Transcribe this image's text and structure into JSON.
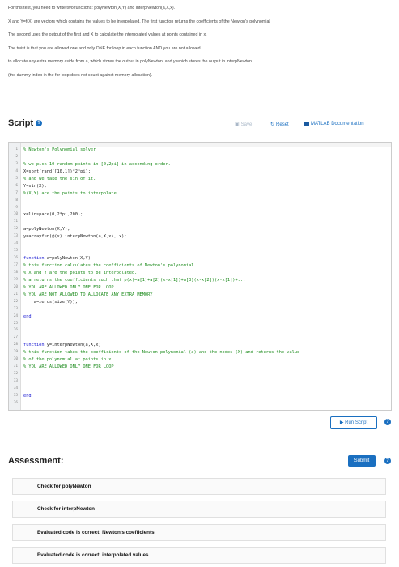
{
  "description": [
    "For this test, you need to write two functions: polyNewton(X,Y) and interpNewton(a,X,x).",
    "X and Y=f(X) are vectors which contains the values to be interpolated. The first function returns the coefficients of the Newton's polynomial",
    "The second uses the output of the first and X to calculate the interpolated values at points contained in x.",
    "The twist is that you are allowed one and only ONE for loop in each function AND you are not allowed",
    "to allocate any extra memory aside from a, which stores the output in polyNewton, and y which stores the output in interpNewton",
    "(the dummy index in the for loop does not count against memory allocation)."
  ],
  "script": {
    "title": "Script",
    "save_label": "Save",
    "reset_label": "Reset",
    "docs_label": "MATLAB Documentation"
  },
  "code_lines": [
    {
      "n": "1",
      "t": "% Newton's Polynomial solver",
      "c": true
    },
    {
      "n": "2",
      "t": "",
      "c": false
    },
    {
      "n": "3",
      "t": "% we pick 10 random points in [0,2pi] in ascending order.",
      "c": true
    },
    {
      "n": "4",
      "t": "X=sort(rand([10,1])*2*pi);",
      "c": false
    },
    {
      "n": "5",
      "t": "% and we take the sin of it.",
      "c": true
    },
    {
      "n": "6",
      "t": "Y=sin(X);",
      "c": false
    },
    {
      "n": "7",
      "t": "%(X,Y) are the points to interpolate.",
      "c": true
    },
    {
      "n": "8",
      "t": "",
      "c": false
    },
    {
      "n": "9",
      "t": "",
      "c": false
    },
    {
      "n": "10",
      "t": "x=linspace(0,2*pi,200);",
      "c": false
    },
    {
      "n": "11",
      "t": "",
      "c": false
    },
    {
      "n": "12",
      "t": "a=polyNewton(X,Y);",
      "c": false
    },
    {
      "n": "13",
      "t": "y=arrayfun(@(x) interpNewton(a,X,x), x);",
      "c": false
    },
    {
      "n": "14",
      "t": "",
      "c": false
    },
    {
      "n": "15",
      "t": "",
      "c": false
    },
    {
      "n": "16",
      "t": "function a=polyNewton(X,Y)",
      "c": false,
      "kw": "function"
    },
    {
      "n": "17",
      "t": "% this function calculates the coefficients of Newton's polynomial",
      "c": true
    },
    {
      "n": "18",
      "t": "% X and Y are the points to be interpolated.",
      "c": true
    },
    {
      "n": "19",
      "t": "% a returns the coefficients such that p(x)=a[1]+a[2](x-x[1])+a[3](x-x[2])(x-x[1])+...",
      "c": true
    },
    {
      "n": "20",
      "t": "% YOU ARE ALLOWED ONLY ONE FOR LOOP",
      "c": true
    },
    {
      "n": "21",
      "t": "% YOU ARE NOT ALLOWED TO ALLOCATE ANY EXTRA MEMORY",
      "c": true
    },
    {
      "n": "22",
      "t": "    a=zeros(size(Y));",
      "c": false
    },
    {
      "n": "23",
      "t": "",
      "c": false
    },
    {
      "n": "24",
      "t": "end",
      "c": false,
      "kw": "end"
    },
    {
      "n": "25",
      "t": "",
      "c": false
    },
    {
      "n": "26",
      "t": "",
      "c": false
    },
    {
      "n": "27",
      "t": "",
      "c": false
    },
    {
      "n": "28",
      "t": "function y=interpNewton(a,X,x)",
      "c": false,
      "kw": "function"
    },
    {
      "n": "29",
      "t": "% this function takes the coefficients of the Newton polynomial (a) and the nodes (X) and returns the value",
      "c": true
    },
    {
      "n": "30",
      "t": "% of the polynomial at points in x",
      "c": true
    },
    {
      "n": "31",
      "t": "% YOU ARE ALLOWED ONLY ONE FOR LOOP",
      "c": true
    },
    {
      "n": "32",
      "t": "",
      "c": false
    },
    {
      "n": "33",
      "t": "",
      "c": false
    },
    {
      "n": "34",
      "t": "",
      "c": false
    },
    {
      "n": "35",
      "t": "end",
      "c": false,
      "kw": "end"
    },
    {
      "n": "36",
      "t": "",
      "c": false
    }
  ],
  "run_label": "Run Script",
  "assessment": {
    "title": "Assessment:",
    "submit_label": "Submit",
    "tests": [
      "Check for polyNewton",
      "Check for interpNewton",
      "Evaluated code is correct: Newton's coefficients",
      "Evaluated code is correct: interpolated values"
    ]
  },
  "colors": {
    "accent": "#1a6fc0",
    "comment": "#1a8a1a",
    "keyword": "#1010d0"
  }
}
